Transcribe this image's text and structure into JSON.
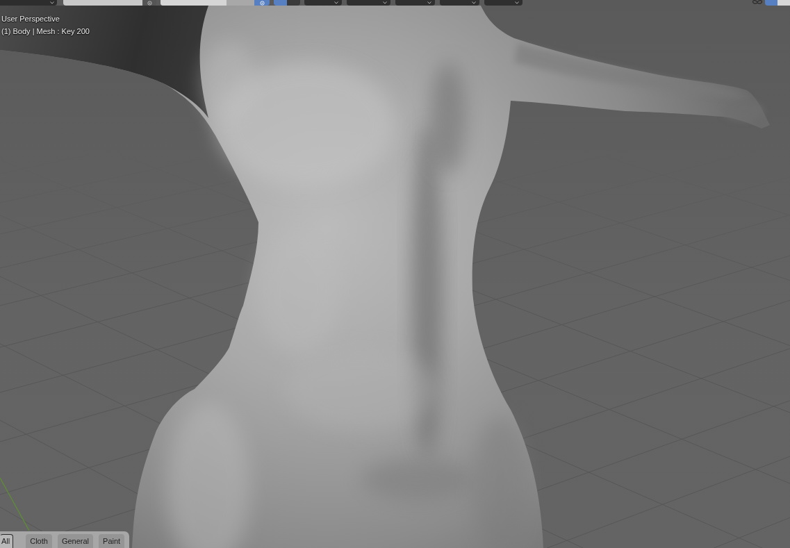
{
  "header": {
    "left": [
      {
        "kind": "dropdown"
      },
      {
        "kind": "field"
      },
      {
        "kind": "ring_button",
        "on": false
      },
      {
        "kind": "slider",
        "level": 0.7
      },
      {
        "kind": "ring_button",
        "on": true
      },
      {
        "kind": "toggle",
        "on": true
      },
      {
        "kind": "toggle",
        "on": false
      },
      {
        "kind": "menu"
      },
      {
        "kind": "menu"
      },
      {
        "kind": "menu"
      },
      {
        "kind": "menu"
      },
      {
        "kind": "menu"
      }
    ],
    "right": [
      {
        "kind": "glyph"
      },
      {
        "kind": "toggle",
        "on": true
      },
      {
        "kind": "toggle",
        "on": false
      }
    ]
  },
  "viewport": {
    "view_name": "User Perspective",
    "object_info": "(1) Body | Mesh : Key 200"
  },
  "tabs": [
    {
      "label": "All",
      "selected": true
    },
    {
      "label": "Cloth",
      "selected": false
    },
    {
      "label": "General",
      "selected": false
    },
    {
      "label": "Paint",
      "selected": false
    }
  ]
}
